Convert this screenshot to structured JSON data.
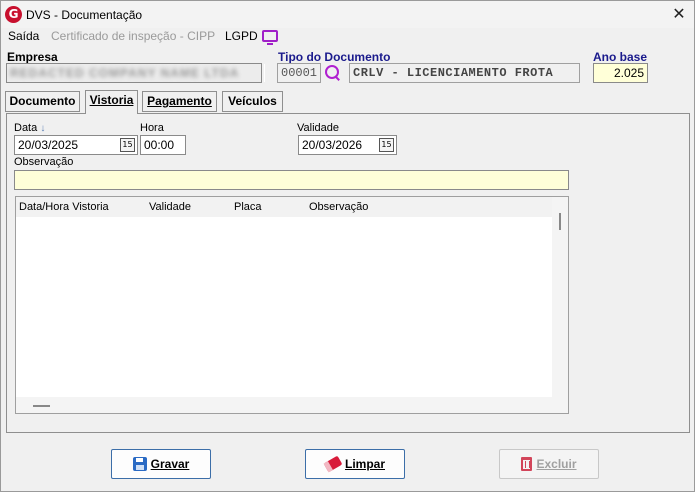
{
  "window": {
    "title": "DVS - Documentação",
    "close_glyph": "✕",
    "logo_letter": "G"
  },
  "menu": {
    "items": [
      {
        "label": "Saída",
        "enabled": true
      },
      {
        "label": "Certificado de inspeção - CIPP",
        "enabled": false
      },
      {
        "label": "LGPD",
        "enabled": true
      }
    ],
    "lgpd_icon": "monitor-icon"
  },
  "header": {
    "empresa_label": "Empresa",
    "empresa_value": "REDACTED COMPANY NAME LTDA",
    "tipo_documento_label": "Tipo do Documento",
    "tipo_codigo": "00001",
    "tipo_descricao": "CRLV - LICENCIAMENTO FROTA",
    "ano_base_label": "Ano base",
    "ano_base_value": "2.025"
  },
  "tabs": [
    {
      "label": "Documento",
      "active": false
    },
    {
      "label": "Vistoria",
      "active": true
    },
    {
      "label": "Pagamento",
      "active": false
    },
    {
      "label": "Veículos",
      "active": false
    }
  ],
  "vistoria": {
    "data_label": "Data",
    "data_sort_icon": "↓",
    "data_value": "20/03/2025",
    "hora_label": "Hora",
    "hora_value": "00:00",
    "validade_label": "Validade",
    "validade_value": "20/03/2026",
    "observacao_label": "Observação",
    "observacao_value": "",
    "calendar_glyph": "15",
    "grid_columns": [
      "Data/Hora Vistoria",
      "Validade",
      "Placa",
      "Observação"
    ],
    "grid_rows": []
  },
  "buttons": {
    "gravar": {
      "label": "Gravar",
      "enabled": true
    },
    "limpar": {
      "label": "Limpar",
      "enabled": true
    },
    "excluir": {
      "label": "Excluir",
      "enabled": false
    }
  },
  "colors": {
    "accent_purple": "#a020c8",
    "required_yellow": "#ffffd8",
    "label_blue": "#1a1a8c",
    "logo_red": "#c8102e"
  }
}
